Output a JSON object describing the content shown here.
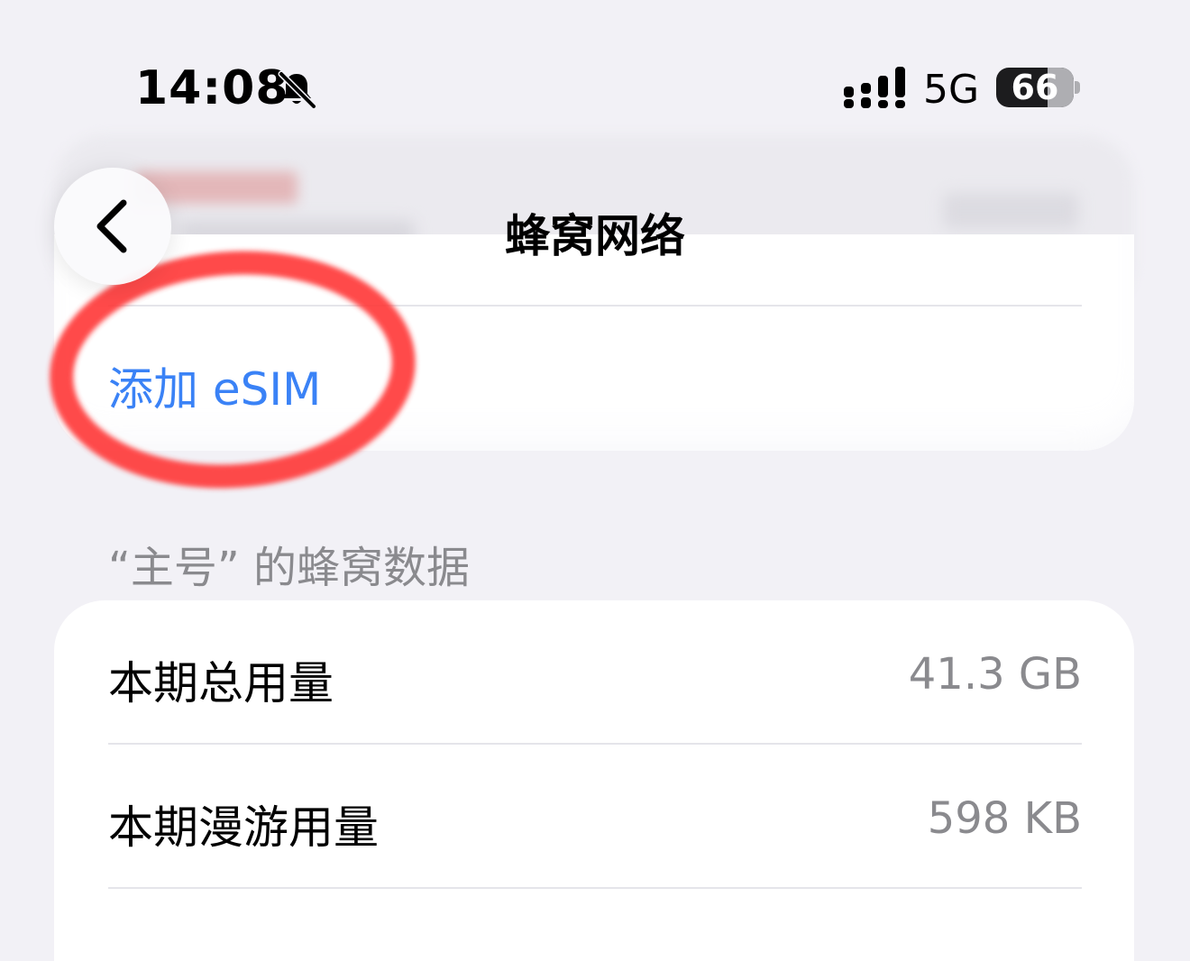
{
  "status_bar": {
    "time": "14:08",
    "network": "5G",
    "battery": "66",
    "battery_level": 0.66
  },
  "nav": {
    "title": "蜂窝网络",
    "back_icon": "chevron-left-icon"
  },
  "esim": {
    "add_label": "添加 eSIM"
  },
  "usage_section": {
    "header": "“主号” 的蜂窝数据",
    "rows": [
      {
        "label": "本期总用量",
        "value": "41.3 GB"
      },
      {
        "label": "本期漫游用量",
        "value": "598 KB"
      }
    ]
  },
  "colors": {
    "accent_link": "#3a82f6",
    "highlight_ring": "#ff3b3b",
    "background": "#f2f1f6"
  }
}
